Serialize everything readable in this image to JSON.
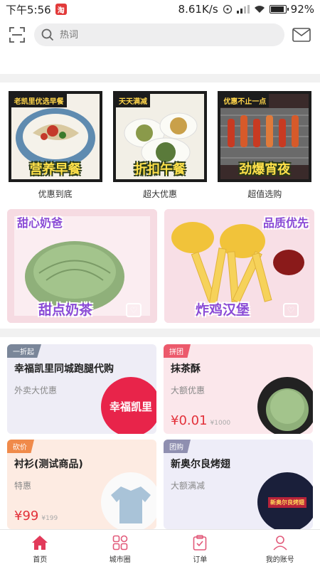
{
  "status_bar": {
    "time": "下午5:56",
    "app_badge": "淘",
    "network_speed": "8.61K/s",
    "battery": "92%",
    "battery_level": 0.92
  },
  "header": {
    "search_placeholder": "热词"
  },
  "categories": [
    {
      "tag": "老凯里优选早餐",
      "title": "营养早餐",
      "label": "优惠到底"
    },
    {
      "tag": "天天满减",
      "title": "折扣午餐",
      "label": "超大优惠"
    },
    {
      "tag": "优惠不止一点",
      "title": "劲爆宵夜",
      "label": "超值选购"
    }
  ],
  "promos": [
    {
      "top_text": "甜心奶爸",
      "bottom_text": "甜点奶茶"
    },
    {
      "top_text": "品质优先",
      "bottom_text": "炸鸡汉堡"
    }
  ],
  "deals": [
    {
      "badge": "一折起",
      "title": "幸福凯里同城跑腿代购",
      "subtitle": "外卖大优惠",
      "price": "",
      "old_price": "",
      "thumb_text": "幸福凯里"
    },
    {
      "badge": "拼团",
      "title": "抹茶酥",
      "subtitle": "大额优惠",
      "price": "¥0.01",
      "old_price": "¥1000",
      "thumb_text": ""
    },
    {
      "badge": "砍价",
      "title": "衬衫(测试商品)",
      "subtitle": "特惠",
      "price": "¥99",
      "old_price": "¥199",
      "thumb_text": ""
    },
    {
      "badge": "团购",
      "title": "新奥尔良烤翅",
      "subtitle": "大额满减",
      "price": "",
      "old_price": "",
      "thumb_text": "新奥尔良烤翅"
    }
  ],
  "nav": [
    {
      "label": "首页",
      "icon": "home-icon"
    },
    {
      "label": "城市圈",
      "icon": "grid-icon"
    },
    {
      "label": "订单",
      "icon": "clipboard-icon"
    },
    {
      "label": "我的账号",
      "icon": "user-icon"
    }
  ],
  "colors": {
    "accent": "#e3313a",
    "nav_active": "#e23a5a",
    "nav_inactive": "#e25a7a"
  }
}
